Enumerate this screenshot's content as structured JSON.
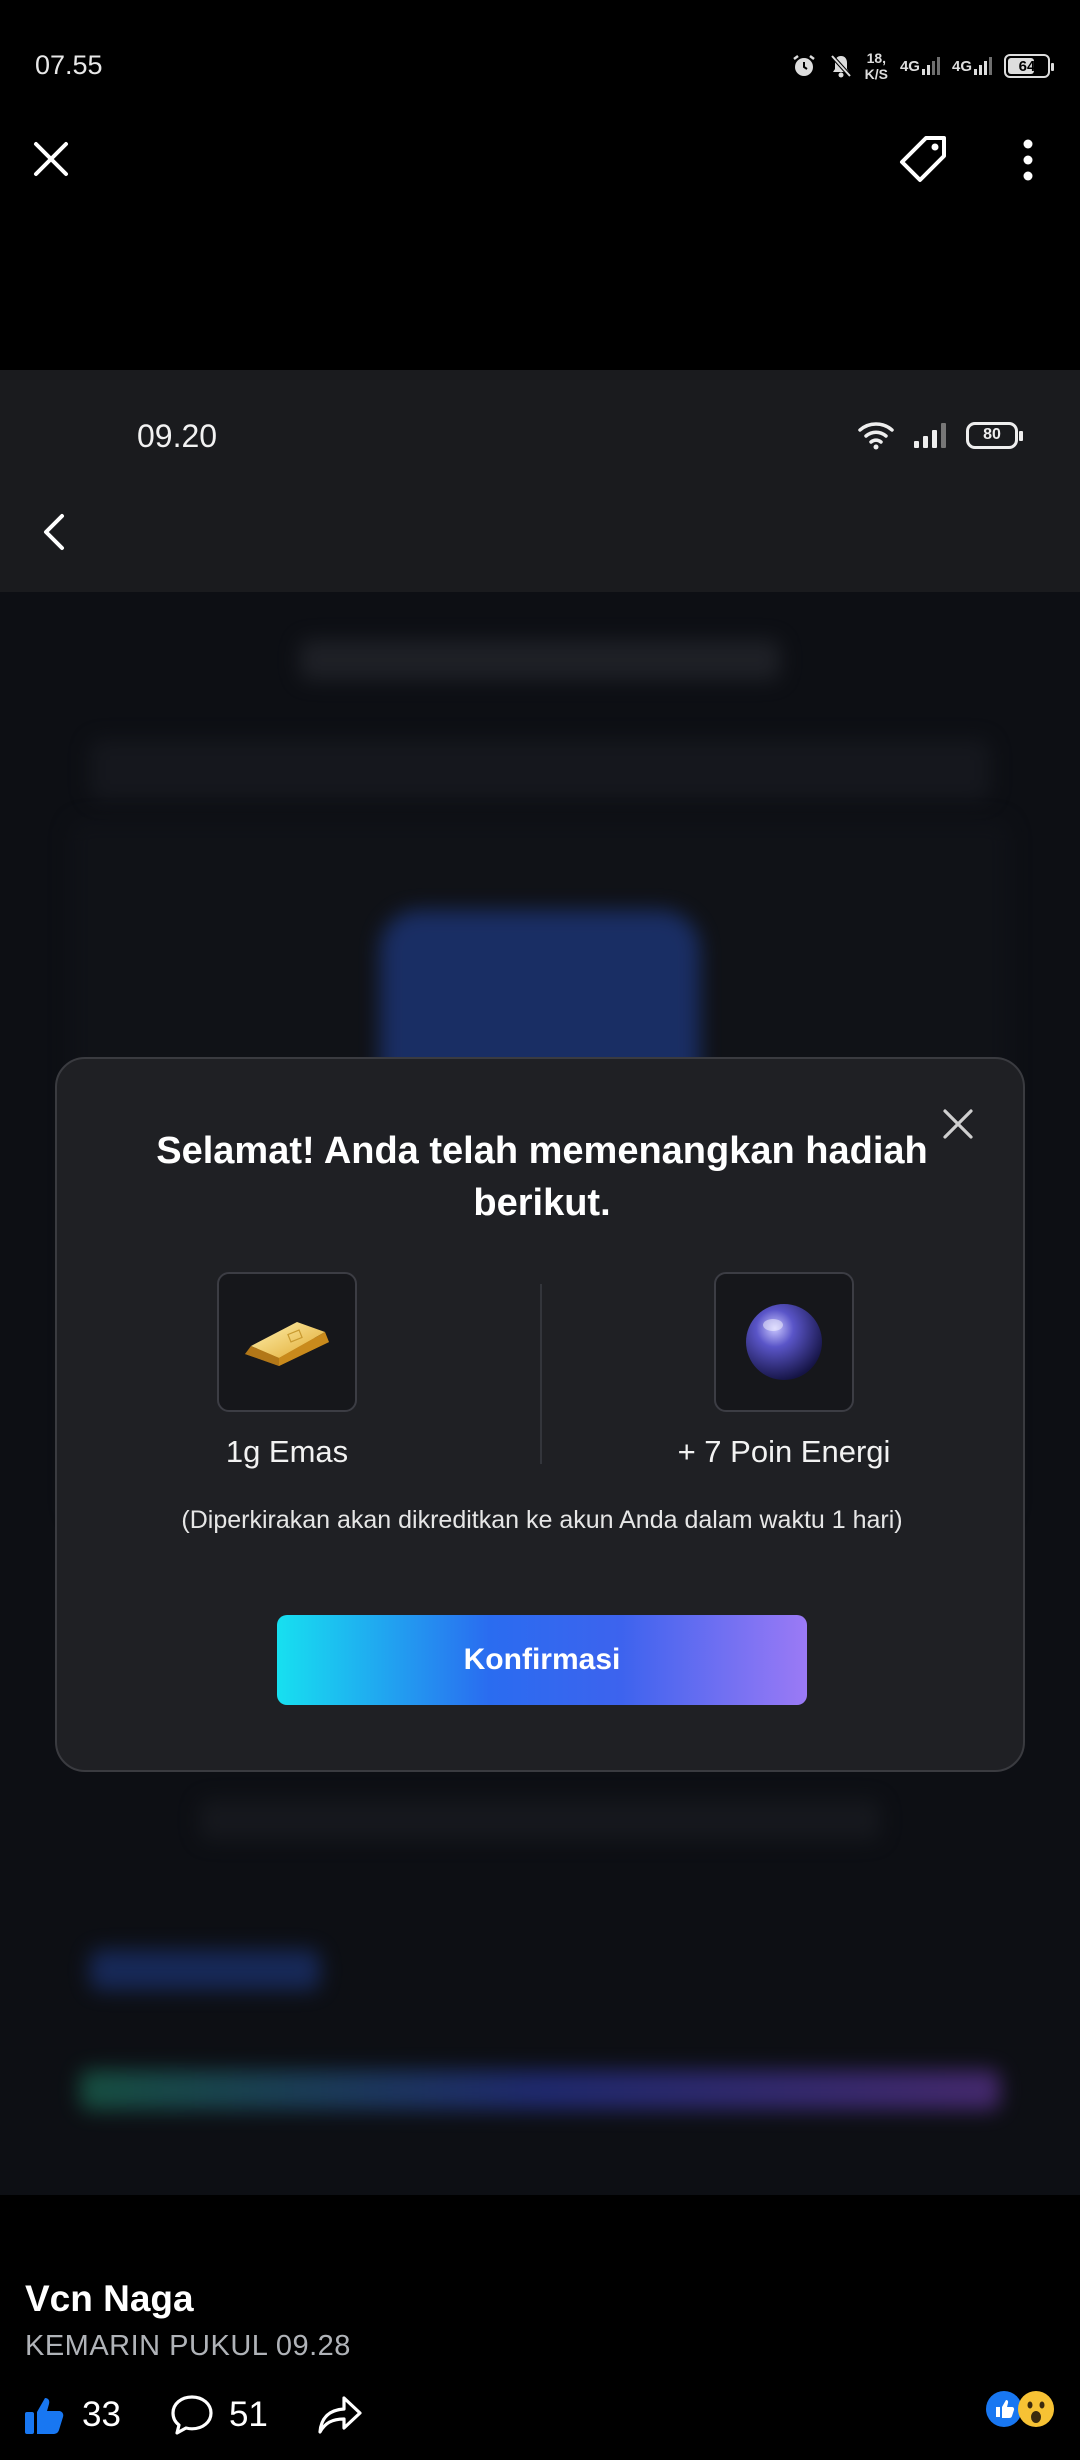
{
  "status_bar": {
    "time": "07.55",
    "speed_value": "18,",
    "speed_unit": "K/S",
    "network_1": "4G",
    "network_2": "4G",
    "battery": "64"
  },
  "inner": {
    "time": "09.20",
    "battery": "80"
  },
  "dialog": {
    "title": "Selamat! Anda telah memenangkan hadiah berikut.",
    "prizes": [
      {
        "label": "1g Emas",
        "icon": "gold-bar-icon"
      },
      {
        "label": "+ 7 Poin Energi",
        "icon": "energy-orb-icon"
      }
    ],
    "note": "(Diperkirakan akan dikreditkan ke akun Anda dalam waktu 1 hari)",
    "confirm_label": "Konfirmasi"
  },
  "post": {
    "author": "Vcn Naga",
    "timestamp": "KEMARIN PUKUL 09.28",
    "likes": "33",
    "comments": "51"
  },
  "colors": {
    "accent_gradient_start": "#17e0f0",
    "accent_gradient_mid": "#2a6cf0",
    "accent_gradient_end": "#9b7af5",
    "like_blue": "#1877f2"
  }
}
